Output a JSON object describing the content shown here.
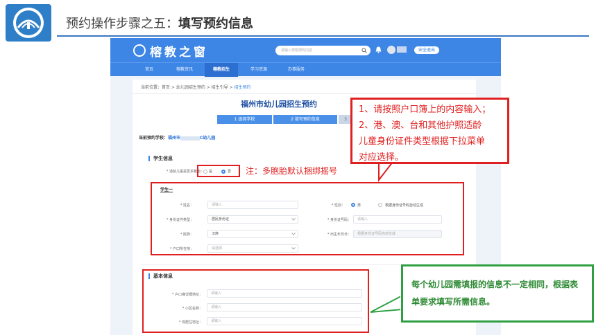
{
  "slide": {
    "title_prefix": "预约操作步骤之五：",
    "title_bold": "填写预约信息"
  },
  "portal": {
    "brand": "榕教之窗",
    "search_placeholder": "请输入您想搜的内容",
    "logout": "安全退出",
    "nav": [
      "首页",
      "榕教资讯",
      "榕教招生",
      "学习资源",
      "办事服务"
    ],
    "breadcrumb": {
      "prefix": "当前位置：首页 > 幼儿园招生预约 > 招生引导 > ",
      "current": "招生预约"
    },
    "page_title": "福州市幼儿园招生预约",
    "steps": [
      {
        "num": "1",
        "label": "选择学校"
      },
      {
        "num": "2",
        "label": "填写预约信息"
      },
      {
        "num": "3",
        "label": ""
      }
    ],
    "school_label": "当前预约学校：",
    "school_name_left": "福州市",
    "school_name_right": "C幼儿园",
    "student_section": {
      "title": "学生信息",
      "multi_birth_label": "* 适龄儿童是否多胞胎：",
      "options": [
        "是",
        "否"
      ],
      "selected": "否",
      "sub_title": "学生一",
      "fields": {
        "name": {
          "label": "* 姓名：",
          "placeholder": "请输入"
        },
        "gender": {
          "label": "* 性别：",
          "option_male": "男",
          "option_auto": "根据身份证号码自动生成"
        },
        "id_type": {
          "label": "* 身份证件类型：",
          "value": "居民身份证"
        },
        "id_number": {
          "label": "* 身份证号码：",
          "placeholder": "请输入"
        },
        "ethnicity": {
          "label": "* 民族：",
          "value": "汉族"
        },
        "birth_date": {
          "label": "* 出生年月日：",
          "placeholder": "根据身份证号码自动生成"
        },
        "hukou_place": {
          "label": "* 户口所在地：",
          "placeholder": "请选择"
        }
      }
    },
    "basic_section": {
      "title": "基本信息",
      "fields": [
        {
          "label": "* 户口簿详细地址：",
          "placeholder": "请输入"
        },
        {
          "label": "* 小区名称：",
          "placeholder": "请输入"
        },
        {
          "label": "* 现居住地址：",
          "placeholder": "请输入"
        }
      ]
    }
  },
  "annotations": {
    "red_callout": [
      "1、请按照户口簿上的内容输入；",
      "2、港、澳、台和其他护照适龄",
      "儿童身份证件类型根据下拉菜单",
      "对应选择。"
    ],
    "red_note": "注：多胞胎默认捆绑摇号",
    "green_callout": [
      "每个幼儿园需填报的信息不一定相同，根据表",
      "单要求填写所需信息。"
    ]
  },
  "colors": {
    "portal_blue": "#3d86e6",
    "annotation_red": "#e02020",
    "annotation_green": "#2ea043"
  }
}
